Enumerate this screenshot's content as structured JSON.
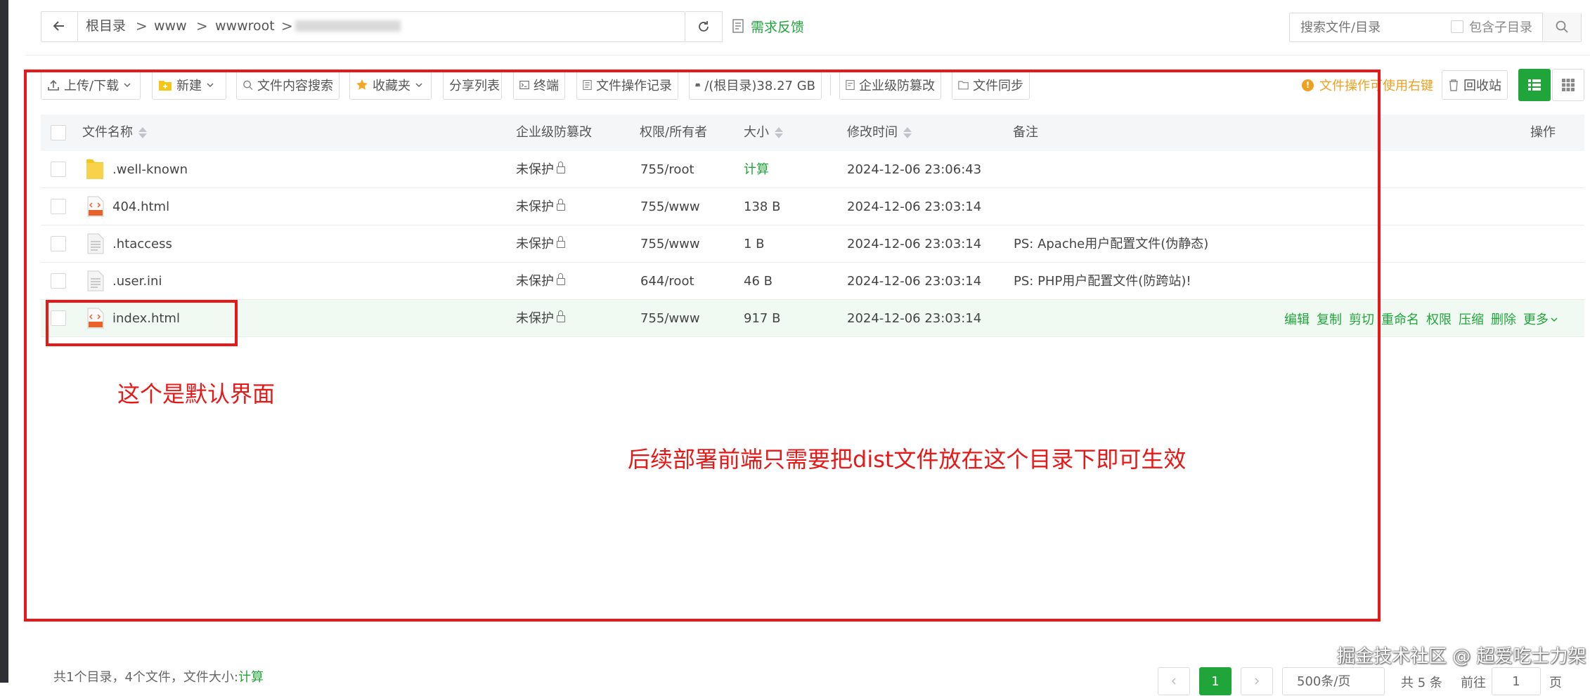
{
  "breadcrumb": {
    "items": [
      "根目录",
      "www",
      "wwwroot"
    ],
    "separator": ">"
  },
  "feedback": {
    "label": "需求反馈"
  },
  "search": {
    "placeholder": "搜索文件/目录",
    "include_subdir_label": "包含子目录"
  },
  "toolbar": {
    "upload_label": "上传/下载",
    "new_label": "新建",
    "content_search_label": "文件内容搜索",
    "favorites_label": "收藏夹",
    "share_list_label": "分享列表",
    "terminal_label": "终端",
    "op_log_label": "文件操作记录",
    "disk_label": "/(根目录)38.27 GB",
    "tamper_label": "企业级防篡改",
    "sync_label": "文件同步",
    "tip_label": "文件操作可使用右键",
    "recycle_label": "回收站"
  },
  "table": {
    "columns": {
      "name": "文件名称",
      "tamper": "企业级防篡改",
      "perm": "权限/所有者",
      "size": "大小",
      "mtime": "修改时间",
      "remark": "备注",
      "actions": "操作"
    },
    "rows": [
      {
        "name": ".well-known",
        "icon": "folder-icon",
        "tamper": "未保护",
        "perm": "755/root",
        "size": "计算",
        "mtime": "2024-12-06 23:06:43",
        "remark": ""
      },
      {
        "name": "404.html",
        "icon": "html-file-icon",
        "tamper": "未保护",
        "perm": "755/www",
        "size": "138 B",
        "mtime": "2024-12-06 23:03:14",
        "remark": ""
      },
      {
        "name": ".htaccess",
        "icon": "text-file-icon",
        "tamper": "未保护",
        "perm": "755/www",
        "size": "1 B",
        "mtime": "2024-12-06 23:03:14",
        "remark": "PS: Apache用户配置文件(伪静态)"
      },
      {
        "name": ".user.ini",
        "icon": "text-file-icon",
        "tamper": "未保护",
        "perm": "644/root",
        "size": "46 B",
        "mtime": "2024-12-06 23:03:14",
        "remark": "PS: PHP用户配置文件(防跨站)!"
      },
      {
        "name": "index.html",
        "icon": "html-file-icon",
        "tamper": "未保护",
        "perm": "755/www",
        "size": "917 B",
        "mtime": "2024-12-06 23:03:14",
        "remark": ""
      }
    ],
    "row_actions": [
      "编辑",
      "复制",
      "剪切",
      "重命名",
      "权限",
      "压缩",
      "删除",
      "更多"
    ]
  },
  "annotations": {
    "default_view": "这个是默认界面",
    "deploy_note": "后续部署前端只需要把dist文件放在这个目录下即可生效"
  },
  "footer": {
    "summary_prefix": "共1个目录，4个文件，文件大小:",
    "summary_calc": "计算",
    "current_page": "1",
    "page_size": "500条/页",
    "total": "共 5 条",
    "goto_label": "前往",
    "goto_value": "1",
    "page_unit": "页"
  },
  "watermark": "掘金技术社区 @ 超爱吃士力架",
  "colors": {
    "accent": "#20a53a",
    "warning": "#f0a020",
    "annotation": "#e81818"
  }
}
